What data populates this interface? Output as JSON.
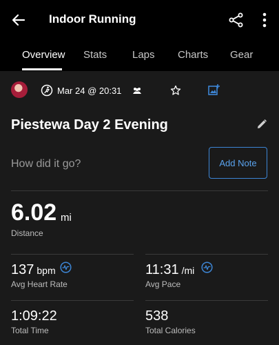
{
  "header": {
    "title": "Indoor Running",
    "tabs": [
      {
        "label": "Overview",
        "active": true
      },
      {
        "label": "Stats"
      },
      {
        "label": "Laps"
      },
      {
        "label": "Charts"
      },
      {
        "label": "Gear"
      }
    ]
  },
  "meta": {
    "date": "Mar 24 @ 20:31",
    "icons": [
      "avatar",
      "activity-type-icon",
      "group-icon",
      "star-icon",
      "add-photo-icon"
    ]
  },
  "activity": {
    "name": "Piestewa Day 2 Evening"
  },
  "feedback": {
    "prompt": "How did it go?",
    "add_note_label": "Add Note"
  },
  "distance": {
    "value": "6.02",
    "unit": "mi",
    "label": "Distance"
  },
  "stats": {
    "heart_rate": {
      "value": "137",
      "unit": "bpm",
      "label": "Avg Heart Rate"
    },
    "pace": {
      "value": "11:31",
      "unit": "/mi",
      "label": "Avg Pace"
    },
    "time": {
      "value": "1:09:22",
      "label": "Total Time"
    },
    "calories": {
      "value": "538",
      "label": "Total Calories"
    }
  },
  "colors": {
    "accent": "#3d86d6",
    "header_bg": "#000000",
    "page_bg": "#1a1a1a"
  }
}
